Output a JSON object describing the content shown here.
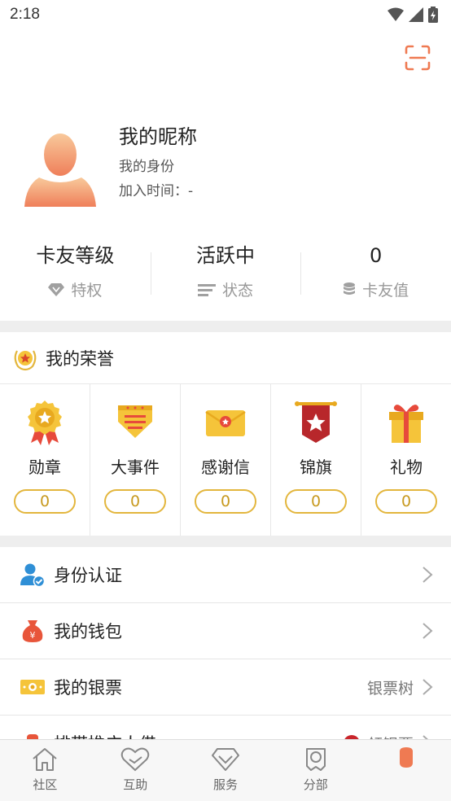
{
  "status_bar": {
    "time": "2:18"
  },
  "profile": {
    "nickname": "我的昵称",
    "identity_label": "我的身份",
    "join_time": "加入时间：-"
  },
  "stats": [
    {
      "value": "卡友等级",
      "sub_label": "特权",
      "icon": "diamond-icon"
    },
    {
      "value": "活跃中",
      "sub_label": "状态",
      "icon": "lines-icon"
    },
    {
      "value": "0",
      "sub_label": "卡友值",
      "icon": "coins-icon"
    }
  ],
  "honor": {
    "title": "我的荣誉",
    "items": [
      {
        "label": "勋章",
        "count": "0",
        "icon": "medal-icon"
      },
      {
        "label": "大事件",
        "count": "0",
        "icon": "event-icon"
      },
      {
        "label": "感谢信",
        "count": "0",
        "icon": "envelope-icon"
      },
      {
        "label": "锦旗",
        "count": "0",
        "icon": "banner-icon"
      },
      {
        "label": "礼物",
        "count": "0",
        "icon": "gift-icon"
      }
    ]
  },
  "menu": [
    {
      "label": "身份认证",
      "right": "",
      "icon": "id-verify-icon"
    },
    {
      "label": "我的钱包",
      "right": "",
      "icon": "wallet-icon"
    },
    {
      "label": "我的银票",
      "right": "银票树",
      "icon": "banknote-icon"
    },
    {
      "label": "排带推广人借",
      "right": "领银票",
      "icon": "promo-icon"
    }
  ],
  "tabbar": [
    {
      "label": "社区",
      "icon": "home-icon"
    },
    {
      "label": "互助",
      "icon": "heart-hands-icon"
    },
    {
      "label": "服务",
      "icon": "diamond-outline-icon"
    },
    {
      "label": "分部",
      "icon": "branch-icon"
    },
    {
      "label": "",
      "icon": "profile-tab-icon"
    }
  ],
  "colors": {
    "accent": "#ef7a52",
    "gold": "#e3b63d",
    "gap": "#eeeeee"
  }
}
